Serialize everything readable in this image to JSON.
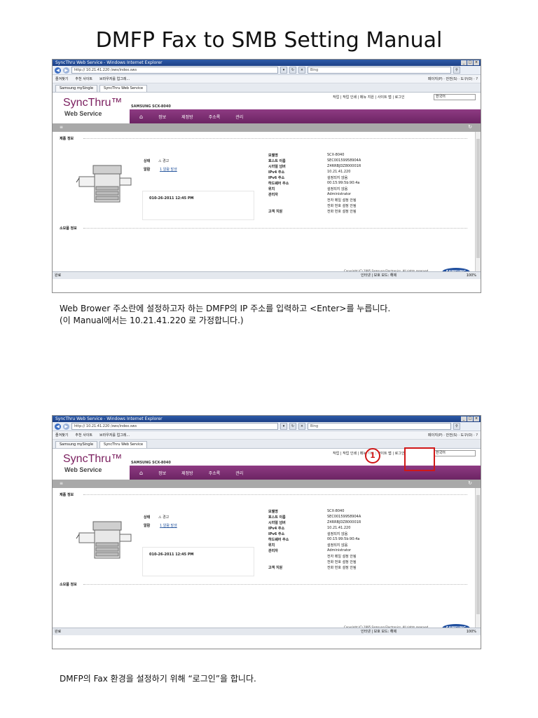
{
  "title": "DMFP Fax to SMB Setting Manual",
  "browser": {
    "window_title": "SyncThru Web Service - Windows Internet Explorer",
    "address": "http:// 10.21.41.220 /sws/index.sws",
    "search_placeholder": "Bing",
    "favorites": [
      "즐겨찾기",
      "추천 사이트",
      "브라우저를 업그레..."
    ],
    "toolbar_right": "페이지(P) · 안전(S) · 도구(O) · ?",
    "tabs": [
      "Samsung mySingle",
      "SyncThru Web Service"
    ],
    "status_left": "완료",
    "status_mid": "인터넷 | 보호 모드: 해제",
    "zoom": "100%"
  },
  "sws": {
    "top_links": "작업 | 작업 인쇄 | 메뉴 지원 | 사이트 맵 | 로그인",
    "language": "한국어",
    "logo_main": "SyncThru™",
    "logo_sub": "Web Service",
    "model_header": "SAMSUNG SCX-8040",
    "menu": [
      "정보",
      "제정방",
      "주소록",
      "관리"
    ],
    "sections": {
      "product_info": "제품 정보",
      "consumables": "소모품 정보"
    },
    "status_labels": {
      "status": "상태",
      "alarm": "알람"
    },
    "status_values": {
      "status": "경고",
      "alarm": "1 알람 발생"
    },
    "timestamp": "010-26-2011 12:45 PM",
    "details": [
      {
        "key": "모델명",
        "value": "SCX-8040"
      },
      {
        "key": "호스트 이름",
        "value": "SEC00159958904A"
      },
      {
        "key": "시리얼 넘버",
        "value": "Z4RRBJDZ800001R"
      },
      {
        "key": "IPv4 주소",
        "value": "10.21.41.220"
      },
      {
        "key": "IPv6 주소",
        "value": "설정되지 않음"
      },
      {
        "key": "하드웨어 주소",
        "value": "00:15:99:5b:90:4a"
      },
      {
        "key": "위치",
        "value": "설정되지 않음"
      },
      {
        "key": "관리자",
        "value": "Administrator"
      },
      {
        "key": "",
        "value": "전자 메일 설정 안됨"
      },
      {
        "key": "",
        "value": "전화 번호 설정 안됨"
      },
      {
        "key": "고객 지원",
        "value": "전화 번호 설정 안됨"
      }
    ],
    "copyright": "Copyright (C) 1995 Samsung Electronics, All rights reserved.",
    "brand": "SAMSUNG"
  },
  "step1": {
    "line1": "Web Brower 주소란에 설정하고자 하는 DMFP의 IP 주소를 입력하고 <Enter>를 누릅니다.",
    "line2": "(이 Manual에서는 10.21.41.220 로 가정합니다.)"
  },
  "step2": {
    "marker": "1",
    "caption": "DMFP의 Fax 환경을 설정하기 위해 “로그인”을 합니다."
  }
}
